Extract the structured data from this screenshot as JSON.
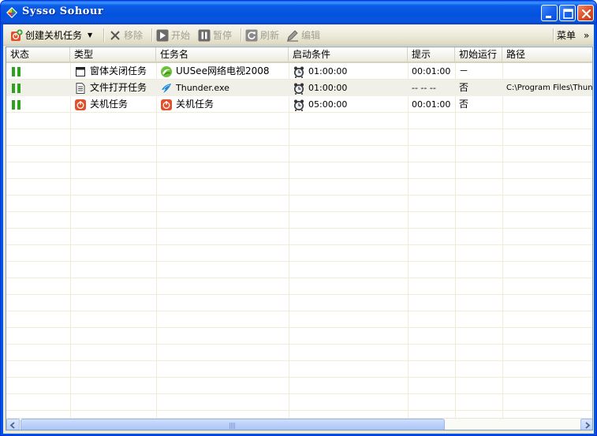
{
  "window": {
    "title": "Sysso Sohour"
  },
  "toolbar": {
    "create_label": "创建关机任务",
    "remove_label": "移除",
    "start_label": "开始",
    "pause_label": "暂停",
    "refresh_label": "刷新",
    "edit_label": "编辑",
    "menu_label": "菜单",
    "more_label": "»"
  },
  "table": {
    "columns": [
      "状态",
      "类型",
      "任务名",
      "启动条件",
      "提示",
      "初始运行",
      "路径"
    ],
    "rows": [
      {
        "status_icon": "pause-icon",
        "type_icon": "window-icon",
        "type": "窗体关闭任务",
        "task_icon": "uusee-logo-icon",
        "task_name": "UUSee网络电视2008",
        "condition_icon": "alarm-clock-icon",
        "condition": "01:00:00",
        "hint": "00:01:00",
        "initial_run": "－",
        "path": ""
      },
      {
        "status_icon": "pause-icon",
        "type_icon": "document-icon",
        "type": "文件打开任务",
        "task_icon": "thunder-logo-icon",
        "task_name": "Thunder.exe",
        "condition_icon": "alarm-clock-icon",
        "condition": "01:00:00",
        "hint": "-- -- --",
        "initial_run": "否",
        "path": "C:\\Program Files\\Thund"
      },
      {
        "status_icon": "pause-icon",
        "type_icon": "power-icon",
        "type": "关机任务",
        "task_icon": "power-icon",
        "task_name": "关机任务",
        "condition_icon": "alarm-clock-icon",
        "condition": "05:00:00",
        "hint": "00:01:00",
        "initial_run": "否",
        "path": ""
      }
    ]
  },
  "colors": {
    "titlebar": "#0a55e0",
    "status_green": "#2ca21d",
    "power_red": "#e0502a",
    "grid_line": "#f0ecd8"
  }
}
